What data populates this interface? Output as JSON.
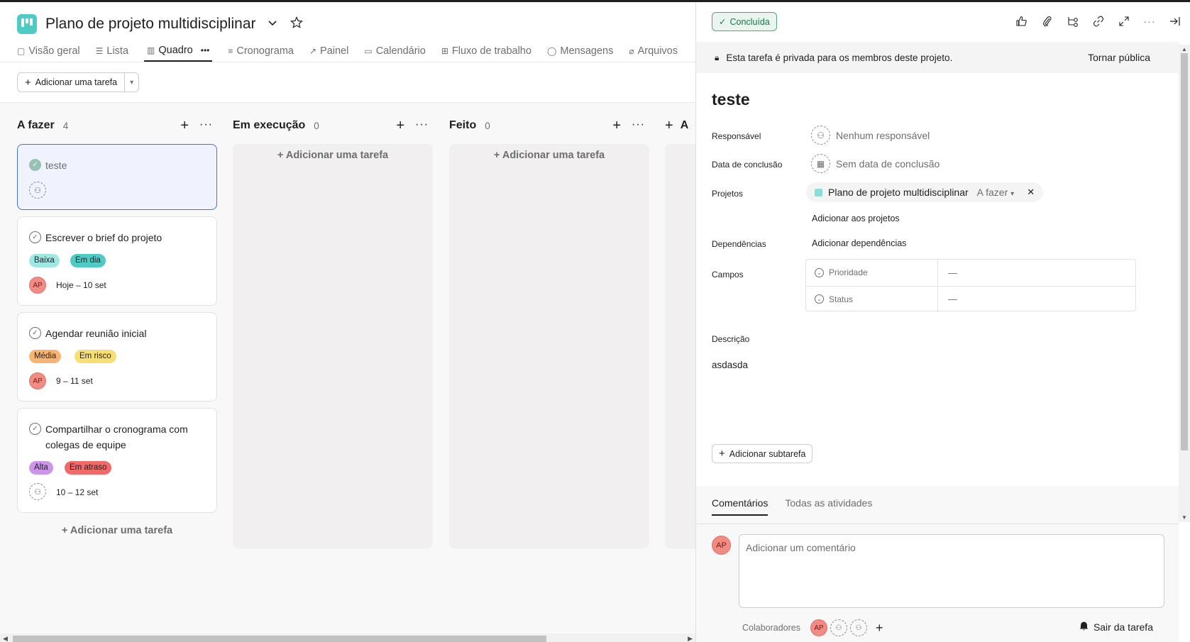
{
  "project": {
    "title": "Plano de projeto multidisciplinar",
    "logo_color": "#4ecbc4"
  },
  "tabs": [
    {
      "label": "Visão geral",
      "icon": "clipboard-icon"
    },
    {
      "label": "Lista",
      "icon": "list-icon"
    },
    {
      "label": "Quadro",
      "icon": "board-icon",
      "active": true
    },
    {
      "label": "Cronograma",
      "icon": "timeline-icon"
    },
    {
      "label": "Painel",
      "icon": "dashboard-icon"
    },
    {
      "label": "Calendário",
      "icon": "calendar-icon"
    },
    {
      "label": "Fluxo de trabalho",
      "icon": "workflow-icon"
    },
    {
      "label": "Mensagens",
      "icon": "message-icon"
    },
    {
      "label": "Arquivos",
      "icon": "attachment-icon"
    }
  ],
  "toolbar": {
    "add_task": "Adicionar uma tarefa"
  },
  "board": {
    "add_task": "+ Adicionar uma tarefa",
    "columns": [
      {
        "title": "A fazer",
        "count": "4",
        "cards": [
          {
            "title": "teste",
            "completed": true,
            "selected": true
          },
          {
            "title": "Escrever o brief do projeto",
            "priority": "Baixa",
            "status": "Em dia",
            "avatar": "AP",
            "date": "Hoje – 10 set"
          },
          {
            "title": "Agendar reunião inicial",
            "priority": "Média",
            "status": "Em risco",
            "avatar": "AP",
            "date": "9 – 11 set"
          },
          {
            "title": "Compartilhar o cronograma com colegas de equipe",
            "priority": "Alta",
            "status": "Em atraso",
            "date": "10 – 12 set"
          }
        ]
      },
      {
        "title": "Em execução",
        "count": "0"
      },
      {
        "title": "Feito",
        "count": "0"
      },
      {
        "title": "A"
      }
    ]
  },
  "colors": {
    "baixa": "#9ee7e3",
    "em_dia": "#4ecbc4",
    "media": "#f8b572",
    "em_risco": "#f8df72",
    "alta": "#cd95ea",
    "em_atraso": "#f06a6a",
    "done_green": "#5da283"
  },
  "detail": {
    "done_label": "Concluída",
    "privacy_text": "Esta tarefa é privada para os membros deste projeto.",
    "make_public": "Tornar pública",
    "task_title": "teste",
    "fields": {
      "assignee_label": "Responsável",
      "assignee_value": "Nenhum responsável",
      "due_label": "Data de conclusão",
      "due_value": "Sem data de conclusão",
      "projects_label": "Projetos",
      "project_name": "Plano de projeto multidisciplinar",
      "project_section": "A fazer",
      "add_to_projects": "Adicionar aos projetos",
      "dependencies_label": "Dependências",
      "add_dependencies": "Adicionar dependências",
      "custom_fields_label": "Campos",
      "priority_label": "Prioridade",
      "priority_value": "—",
      "status_label": "Status",
      "status_value": "—",
      "description_label": "Descrição",
      "description_value": "asdasda"
    },
    "add_subtask": "Adicionar subtarefa",
    "comments_tab": "Comentários",
    "all_activity_tab": "Todas as atividades",
    "comment_placeholder": "Adicionar um comentário",
    "commenter_avatar": "AP",
    "collaborators_label": "Colaboradores",
    "collaborator_avatar": "AP",
    "leave_task": "Sair da tarefa"
  }
}
